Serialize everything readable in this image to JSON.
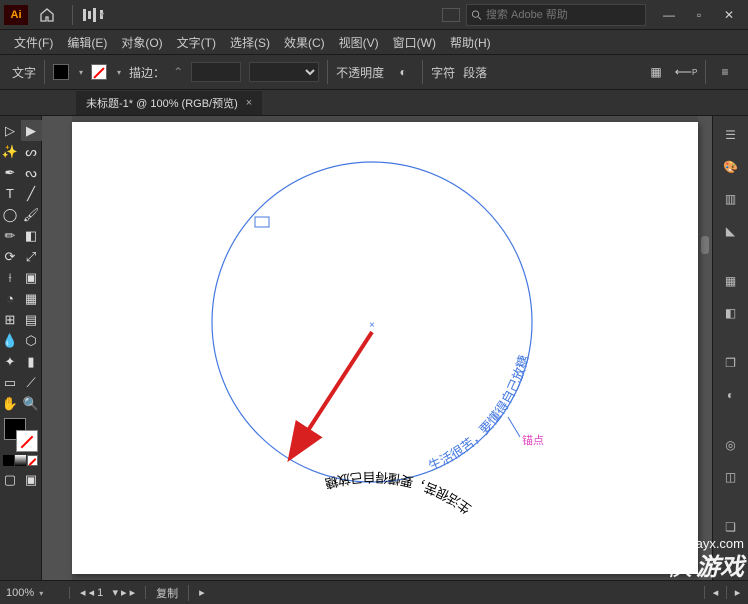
{
  "titlebar": {
    "search_placeholder": "搜索 Adobe 帮助"
  },
  "menubar": {
    "items": [
      "文件(F)",
      "编辑(E)",
      "对象(O)",
      "文字(T)",
      "选择(S)",
      "效果(C)",
      "视图(V)",
      "窗口(W)",
      "帮助(H)"
    ]
  },
  "options": {
    "mode_label": "文字",
    "stroke_label": "描边：",
    "stroke_value": "",
    "opacity_label": "不透明度",
    "char_label": "字符",
    "para_label": "段落"
  },
  "document": {
    "tab_title": "未标题-1* @ 100% (RGB/预览)"
  },
  "canvas": {
    "path_text_blue": "生活很苦，要懂得自己放糖",
    "path_text_black_flipped": "生活很苦，要懂得自己放糖",
    "anchor_label": "锚点"
  },
  "statusbar": {
    "zoom": "100%",
    "mode": "复制"
  },
  "watermark": {
    "domain": "xiayx.com",
    "text": "游戏"
  }
}
